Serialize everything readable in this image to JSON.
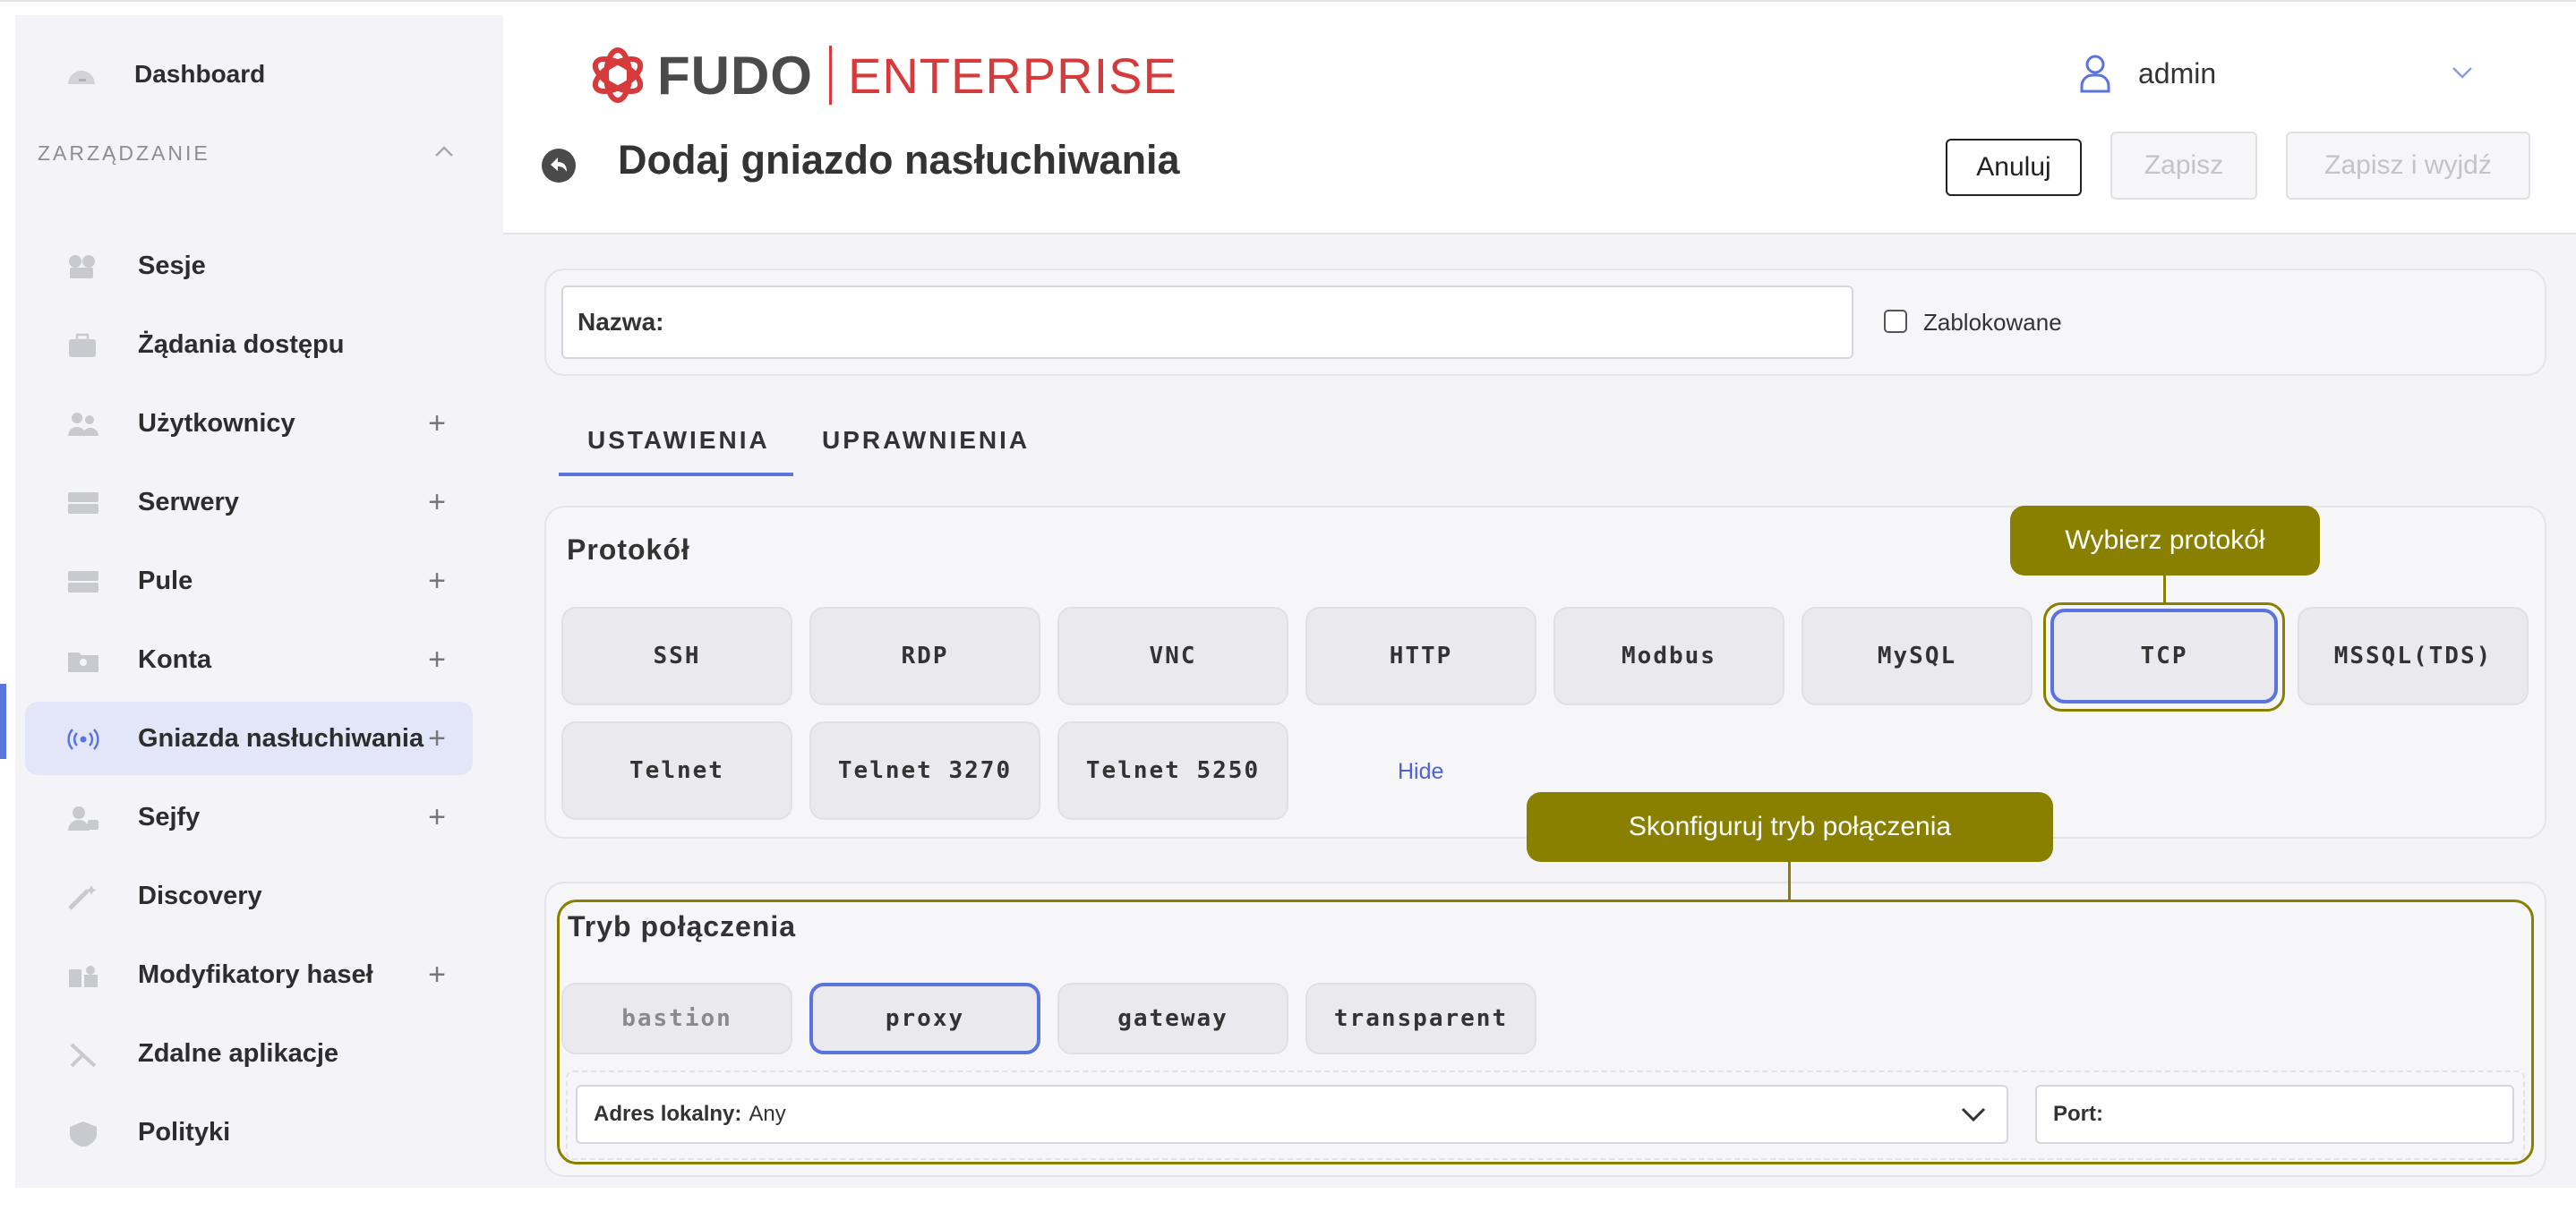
{
  "sidebar": {
    "dashboard_label": "Dashboard",
    "section_title": "ZARZĄDZANIE",
    "items": [
      {
        "label": "Sesje",
        "icon": "camera-icon",
        "expandable": false
      },
      {
        "label": "Żądania dostępu",
        "icon": "briefcase-icon",
        "expandable": false
      },
      {
        "label": "Użytkownicy",
        "icon": "users-icon",
        "expandable": true
      },
      {
        "label": "Serwery",
        "icon": "server-icon",
        "expandable": true
      },
      {
        "label": "Pule",
        "icon": "server-pool-icon",
        "expandable": true
      },
      {
        "label": "Konta",
        "icon": "account-folder-icon",
        "expandable": true
      },
      {
        "label": "Gniazda nasłuchiwania",
        "icon": "broadcast-icon",
        "expandable": true,
        "active": true
      },
      {
        "label": "Sejfy",
        "icon": "safe-user-icon",
        "expandable": true
      },
      {
        "label": "Discovery",
        "icon": "magic-wand-icon",
        "expandable": false
      },
      {
        "label": "Modyfikatory haseł",
        "icon": "puzzle-icon",
        "expandable": true
      },
      {
        "label": "Zdalne aplikacje",
        "icon": "tools-icon",
        "expandable": false
      },
      {
        "label": "Polityki",
        "icon": "shield-icon",
        "expandable": false
      }
    ],
    "plus_symbol": "+"
  },
  "header": {
    "logo_fudo": "FUDO",
    "logo_enterprise": "ENTERPRISE",
    "user_name": "admin"
  },
  "page": {
    "title": "Dodaj gniazdo nasłuchiwania",
    "cancel_label": "Anuluj",
    "save_label": "Zapisz",
    "save_exit_label": "Zapisz i wyjdź"
  },
  "form": {
    "name_label": "Nazwa:",
    "name_value": "",
    "blocked_label": "Zablokowane",
    "blocked_checked": false
  },
  "tabs": [
    {
      "label": "USTAWIENIA",
      "active": true
    },
    {
      "label": "UPRAWNIENIA",
      "active": false
    }
  ],
  "protocol": {
    "heading": "Protokół",
    "options": [
      "SSH",
      "RDP",
      "VNC",
      "HTTP",
      "Modbus",
      "MySQL",
      "TCP",
      "MSSQL(TDS)",
      "Telnet",
      "Telnet 3270",
      "Telnet 5250"
    ],
    "selected": "TCP",
    "hide_label": "Hide",
    "callout": "Wybierz protokół"
  },
  "connection_mode": {
    "heading": "Tryb połączenia",
    "options": [
      "bastion",
      "proxy",
      "gateway",
      "transparent"
    ],
    "selected": "proxy",
    "disabled": [
      "bastion"
    ],
    "callout": "Skonfiguruj tryb połączenia",
    "local_address_label": "Adres lokalny:",
    "local_address_value": "Any",
    "port_label": "Port:",
    "port_value": ""
  },
  "colors": {
    "accent": "#5a74dd",
    "brand_red": "#d63a3a",
    "callout": "#8a8000"
  }
}
